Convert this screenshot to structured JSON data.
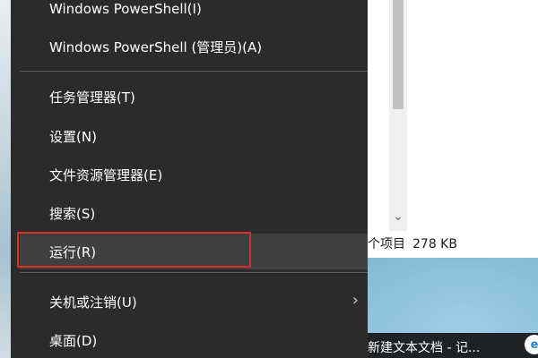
{
  "menu": {
    "items": [
      {
        "label": "Windows PowerShell(I)"
      },
      {
        "label": "Windows PowerShell (管理员)(A)"
      },
      {
        "label": "任务管理器(T)"
      },
      {
        "label": "设置(N)"
      },
      {
        "label": "文件资源管理器(E)"
      },
      {
        "label": "搜索(S)"
      },
      {
        "label": "运行(R)"
      },
      {
        "label": "关机或注销(U)"
      },
      {
        "label": "桌面(D)"
      }
    ],
    "submenu_arrow": "›"
  },
  "explorer": {
    "status_items": "个项目",
    "status_size": "278 KB",
    "scroll_down": "⌄"
  },
  "taskbar": {
    "item_label": "新建文本文档 - 记...",
    "icon_glyph": "e"
  },
  "colors": {
    "menu_bg": "#2b2b2b",
    "highlight_border": "#e02b2b",
    "hover_bg": "#404040"
  }
}
